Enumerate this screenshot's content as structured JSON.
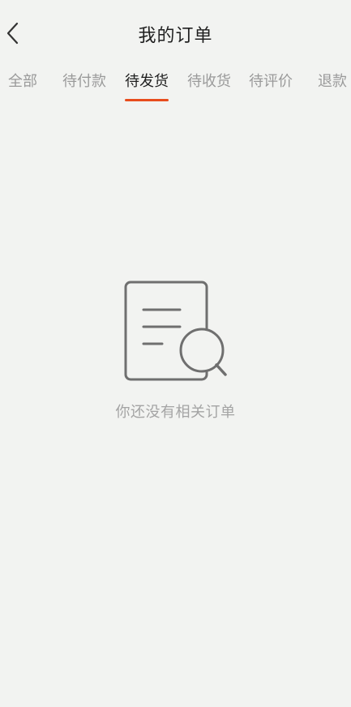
{
  "header": {
    "title": "我的订单",
    "back_icon": "chevron-left-icon"
  },
  "tabs": [
    {
      "label": "全部",
      "active": false
    },
    {
      "label": "待付款",
      "active": false
    },
    {
      "label": "待发货",
      "active": true
    },
    {
      "label": "待收货",
      "active": false
    },
    {
      "label": "待评价",
      "active": false
    },
    {
      "label": "退款",
      "active": false
    }
  ],
  "empty_state": {
    "icon": "document-search-icon",
    "message": "你还没有相关订单"
  },
  "colors": {
    "background": "#f2f3f1",
    "accent": "#e84c1d",
    "active_text": "#1f1f1f",
    "inactive_text": "#9a9a9a"
  }
}
